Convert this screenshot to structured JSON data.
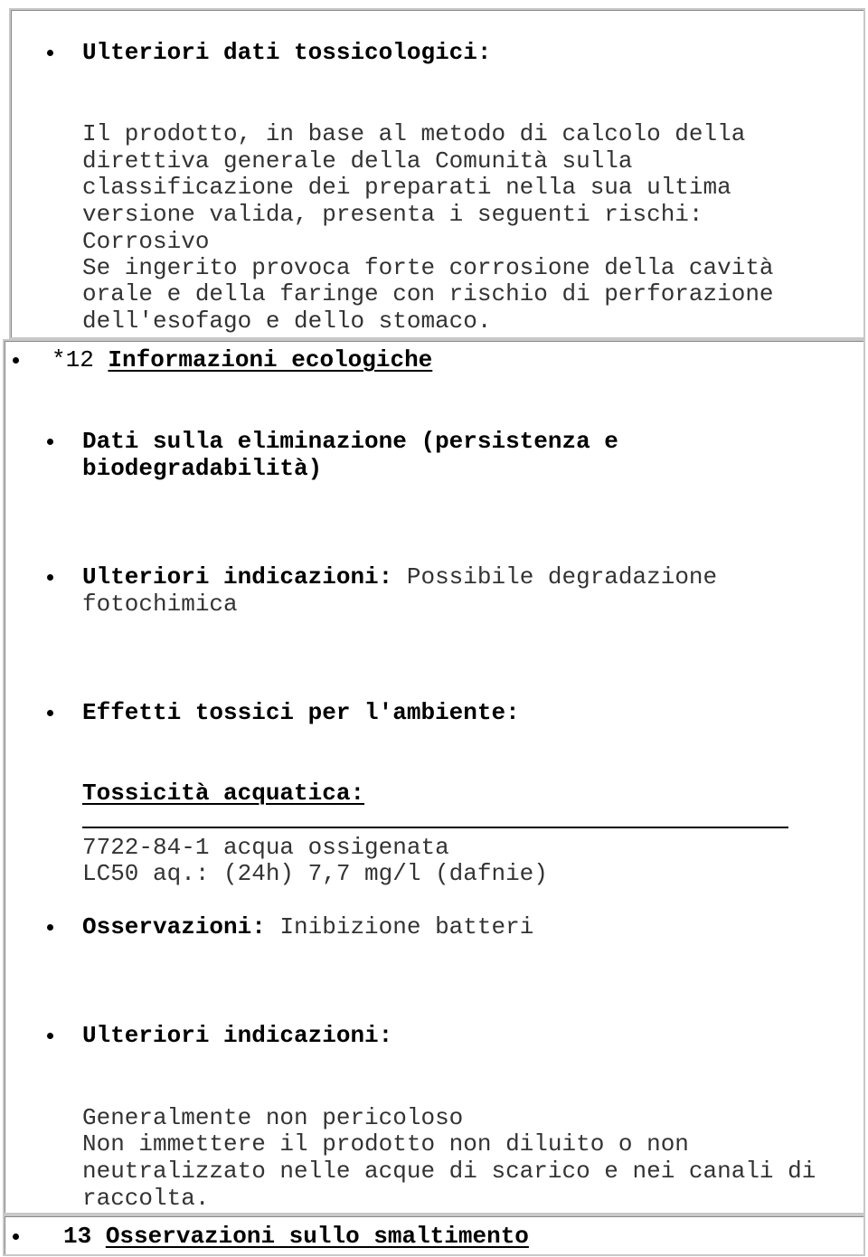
{
  "section11": {
    "further_tox_label": "Ulteriori dati tossicologici:",
    "paragraph": [
      "Il prodotto, in base al metodo di calcolo della",
      "direttiva generale della Comunità sulla",
      "classificazione dei preparati nella sua ultima",
      "versione valida, presenta i seguenti rischi:",
      "Corrosivo",
      "Se ingerito provoca forte corrosione della cavità",
      "orale e della faringe con rischio di perforazione",
      "dell'esofago e dello stomaco."
    ]
  },
  "section12": {
    "number": "*12",
    "title": "Informazioni ecologiche",
    "elimination_label": [
      "Dati sulla eliminazione (persistenza e",
      "biodegradabilità)"
    ],
    "further_label": "Ulteriori indicazioni:",
    "further_value": [
      " Possibile degradazione",
      "fotochimica"
    ],
    "toxic_effects_label": "Effetti tossici per l'ambiente:",
    "aquatic_label": "Tossicità acquatica:",
    "aquatic_lines": [
      "7722-84-1 acqua ossigenata",
      "LC50 aq.: (24h) 7,7 mg/l (dafnie)"
    ],
    "observations_label": "Osservazioni:",
    "observations_value": " Inibizione batteri",
    "further2_label": "Ulteriori indicazioni:",
    "further2_lines": [
      "Generalmente non pericoloso",
      "Non immettere il prodotto non diluito o non",
      "neutralizzato nelle acque di scarico e nei canali di",
      "raccolta."
    ]
  },
  "section13": {
    "number": "13",
    "title": "Osservazioni sullo smaltimento"
  }
}
